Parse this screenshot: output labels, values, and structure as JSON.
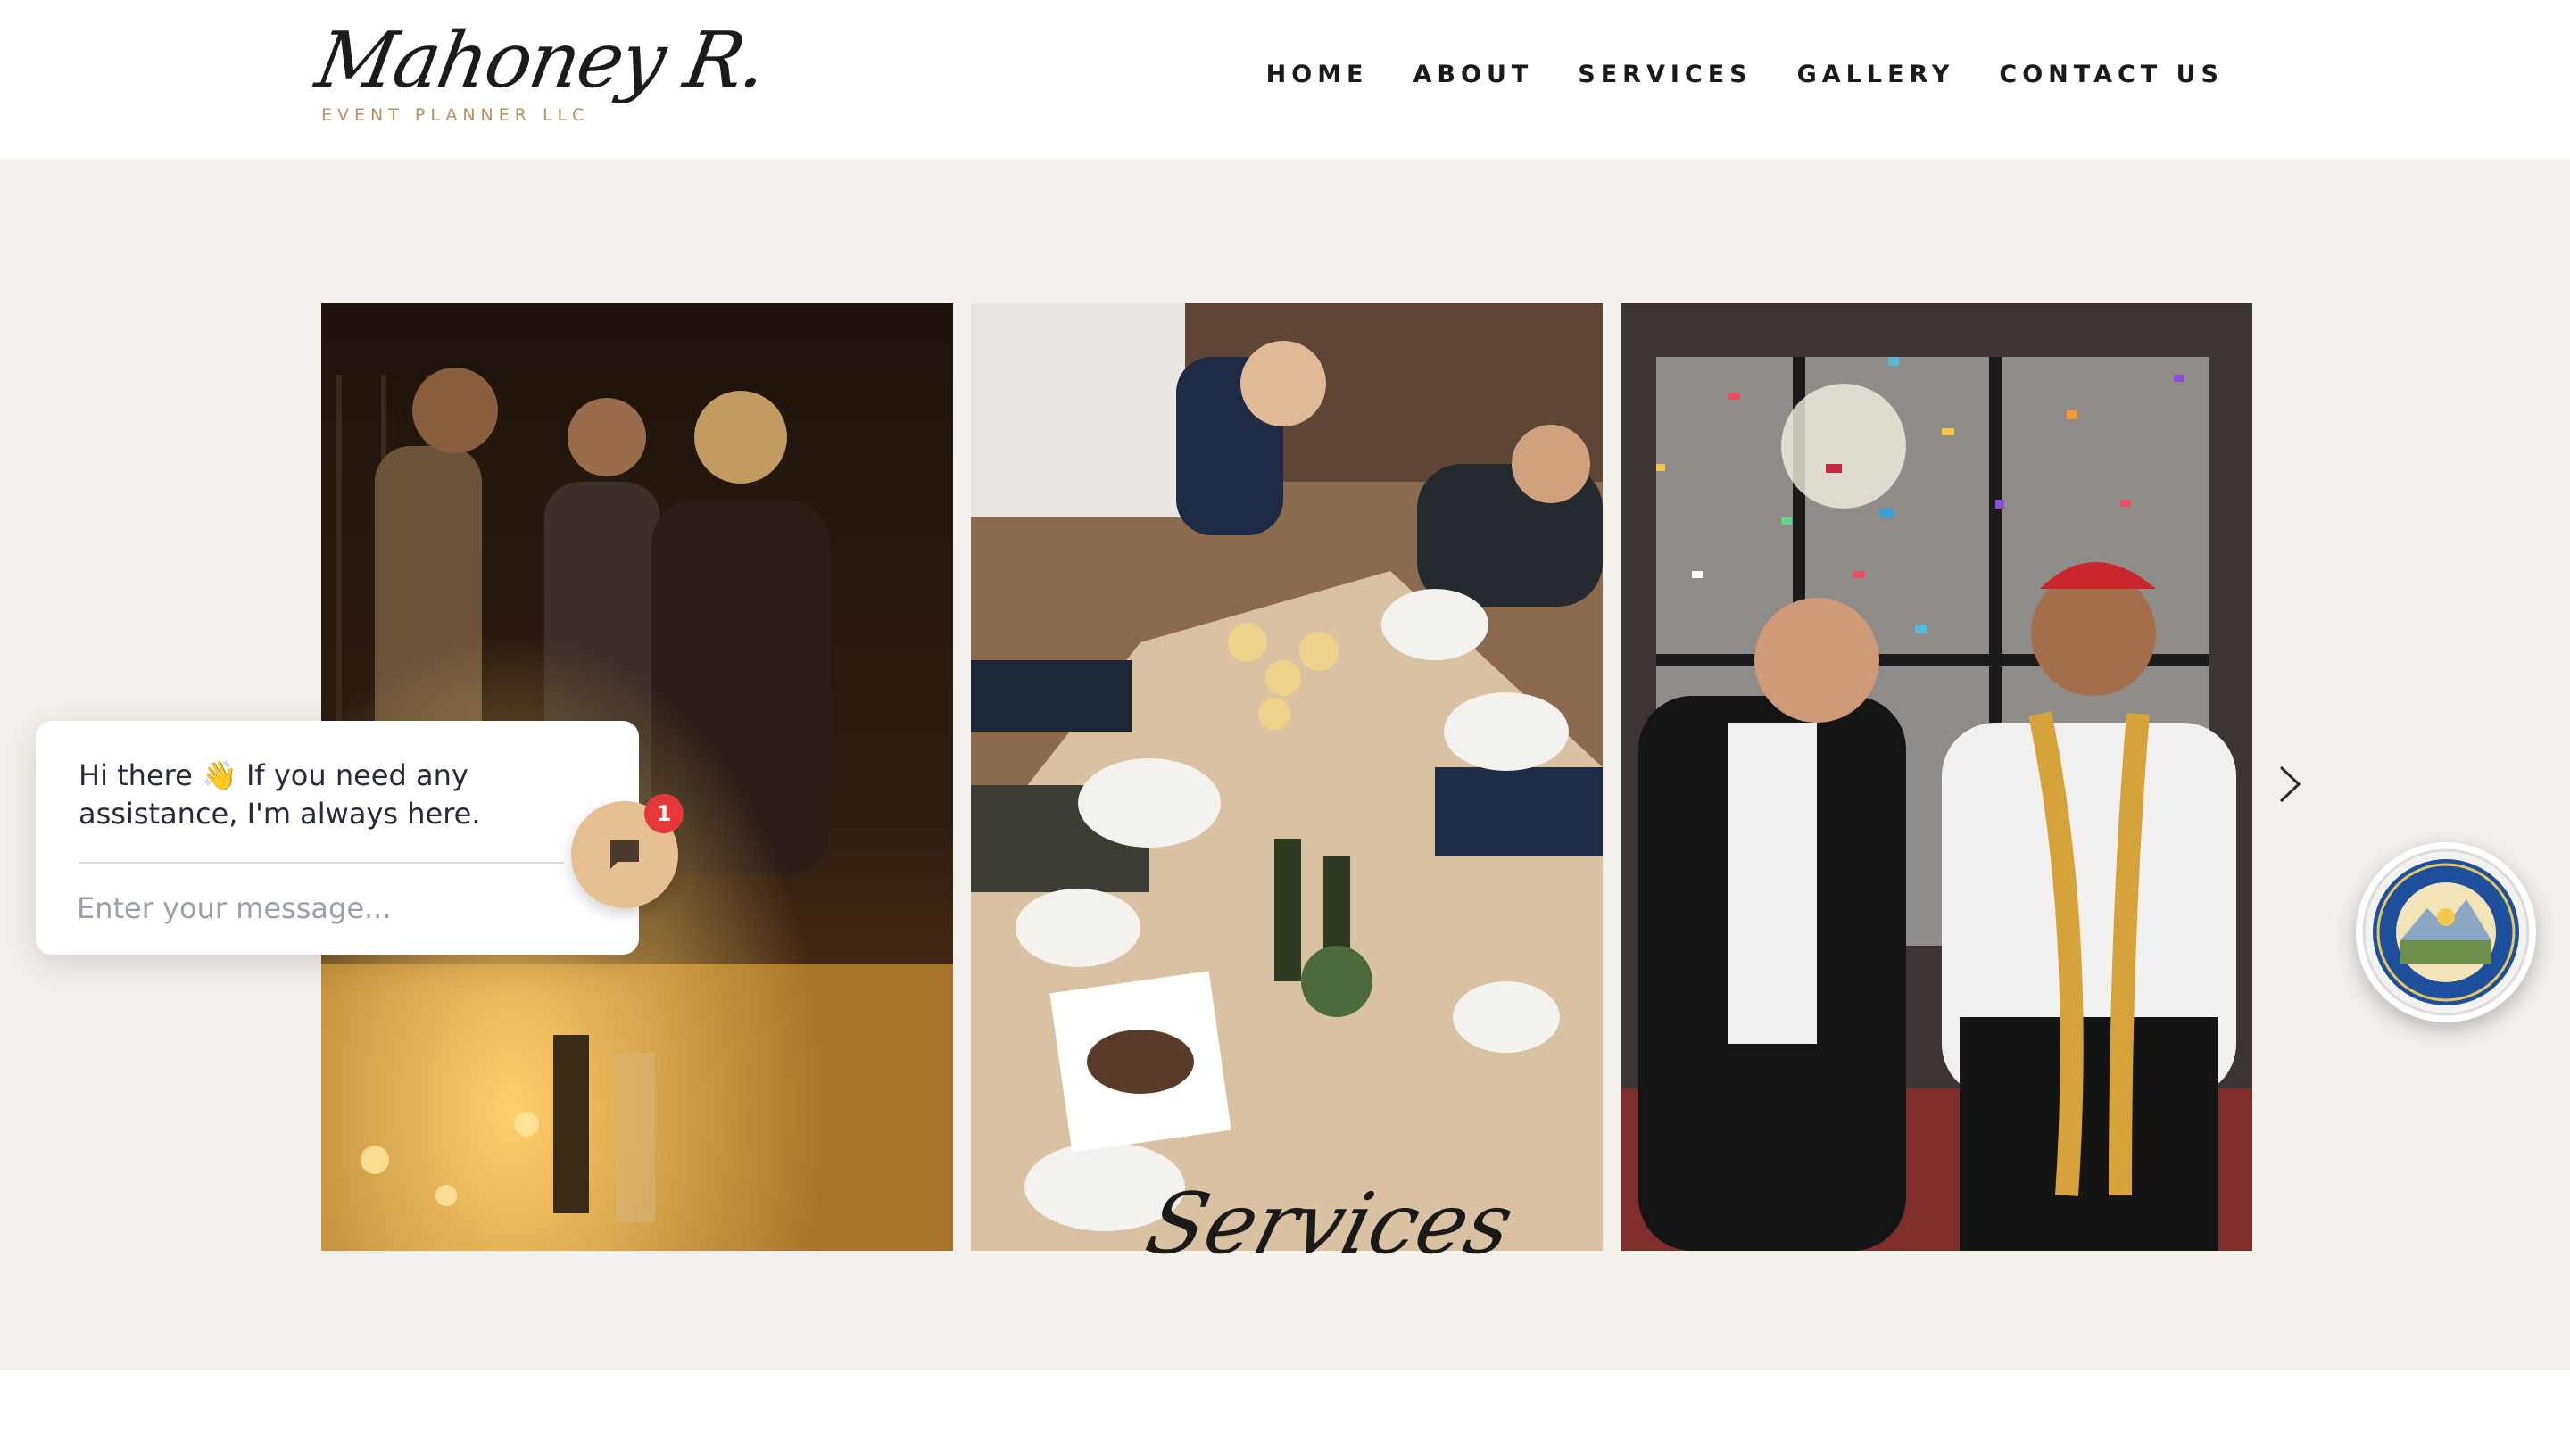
{
  "header": {
    "logo_script": "Mahoney R.",
    "logo_sub": "EVENT PLANNER LLC",
    "nav": [
      "HOME",
      "ABOUT",
      "SERVICES",
      "GALLERY",
      "CONTACT US"
    ]
  },
  "gallery": {
    "heading": "Services",
    "photos": [
      "party-guests-photo",
      "dinner-toast-photo",
      "confetti-celebration-photo"
    ]
  },
  "chat": {
    "greeting": "Hi there 👋 If you need any assistance, I'm always here.",
    "placeholder": "Enter your message...",
    "badge_count": "1"
  },
  "colors": {
    "band_bg": "#f4f0ec",
    "accent_gold": "#b9915e",
    "launcher": "#e6bf92",
    "badge": "#e5383b"
  }
}
